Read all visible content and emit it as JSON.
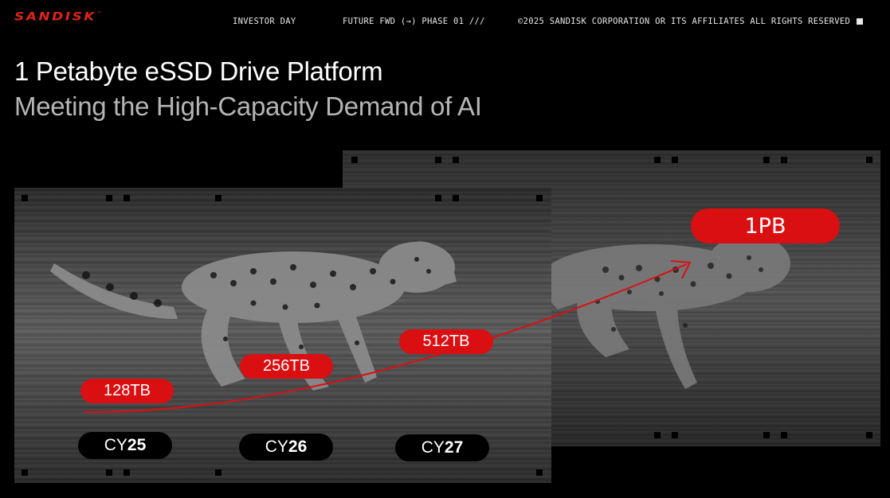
{
  "header": {
    "logo": "SANDISK",
    "logo_tm": "™",
    "event": "INVESTOR DAY",
    "phase": "FUTURE FWD (→) PHASE 01 ///",
    "copyright": "©2025 SANDISK CORPORATION OR ITS AFFILIATES ALL RIGHTS RESERVED"
  },
  "slide": {
    "title": "1 Petabyte eSSD Drive Platform",
    "subtitle": "Meeting the High-Capacity Demand of AI"
  },
  "capacities": [
    {
      "label": "128TB"
    },
    {
      "label": "256TB"
    },
    {
      "label": "512TB"
    },
    {
      "label": "1PB"
    }
  ],
  "years": [
    {
      "prefix": "CY",
      "year": "25"
    },
    {
      "prefix": "CY",
      "year": "26"
    },
    {
      "prefix": "CY",
      "year": "27"
    }
  ],
  "colors": {
    "accent": "#d90f12",
    "logo": "#e0241b",
    "subtitle": "#b5b5b5",
    "background": "#000000"
  },
  "icons": {
    "square": "corner-square-icon",
    "cheetah": "cheetah-image",
    "arrow": "growth-arrow-icon"
  }
}
